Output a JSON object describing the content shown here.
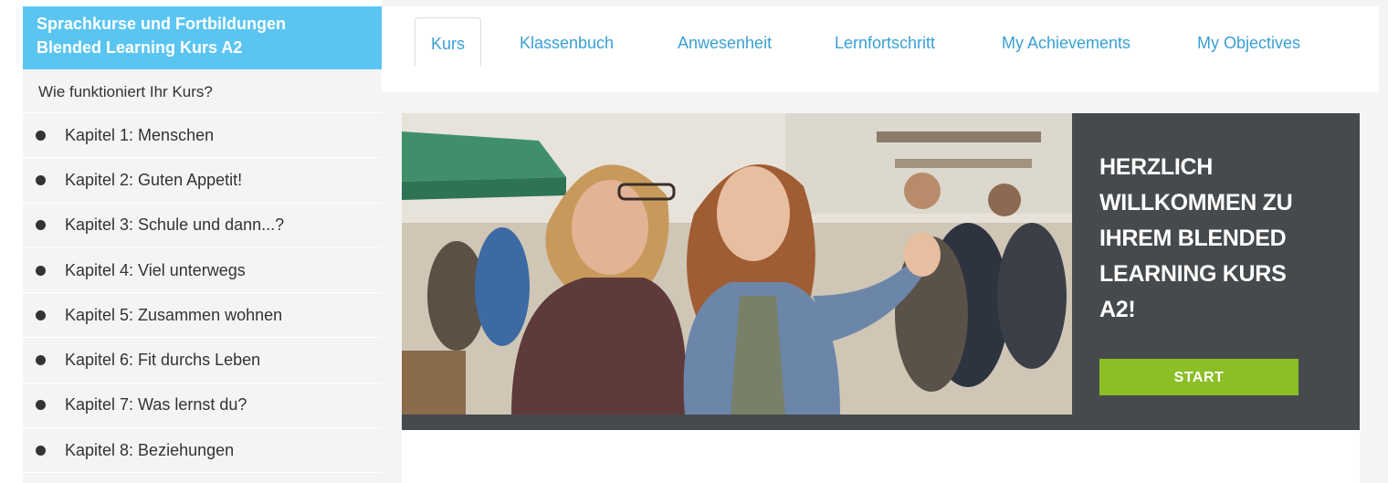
{
  "sidebar": {
    "header_line1": "Sprachkurse und Fortbildungen",
    "header_line2": "Blended Learning Kurs A2",
    "intro": "Wie funktioniert Ihr Kurs?",
    "chapters": [
      {
        "label": "Kapitel 1: Menschen"
      },
      {
        "label": "Kapitel 2: Guten Appetit!"
      },
      {
        "label": "Kapitel 3: Schule und dann...?"
      },
      {
        "label": "Kapitel 4: Viel unterwegs"
      },
      {
        "label": "Kapitel 5: Zusammen wohnen"
      },
      {
        "label": "Kapitel 6: Fit durchs Leben"
      },
      {
        "label": "Kapitel 7: Was lernst du?"
      },
      {
        "label": "Kapitel 8: Beziehungen"
      }
    ]
  },
  "tabs": [
    {
      "label": "Kurs",
      "active": true
    },
    {
      "label": "Klassenbuch",
      "active": false
    },
    {
      "label": "Anwesenheit",
      "active": false
    },
    {
      "label": "Lernfortschritt",
      "active": false
    },
    {
      "label": "My Achievements",
      "active": false
    },
    {
      "label": "My Objectives",
      "active": false
    }
  ],
  "banner": {
    "welcome_lines": [
      "HERZLICH",
      "WILLKOMMEN ZU",
      "IHREM BLENDED",
      "LEARNING KURS",
      "A2!"
    ],
    "start_label": "START",
    "photo_icon": "photo-two-women-market"
  },
  "colors": {
    "sidebar_header": "#5bc5f2",
    "tab_link": "#3a9fd4",
    "banner_panel": "#464a4d",
    "start_button": "#8cbf26"
  }
}
